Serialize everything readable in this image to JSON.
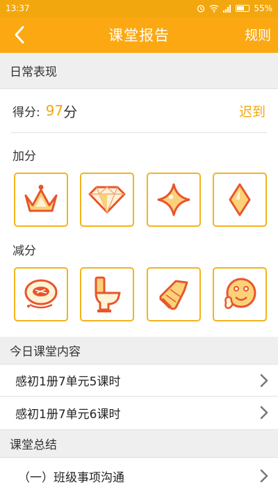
{
  "status": {
    "time": "13:37",
    "battery": "55%"
  },
  "header": {
    "title": "课堂报告",
    "right_action": "规则"
  },
  "daily": {
    "section_title": "日常表现",
    "score_label": "得分:",
    "score_value": "97",
    "score_unit": "分",
    "attendance": "迟到",
    "add_label": "加分",
    "add_icons": [
      "crown-icon",
      "diamond-gem-icon",
      "sparkle-star-icon",
      "rhombus-icon"
    ],
    "deduct_label": "减分",
    "deduct_icons": [
      "food-plate-icon",
      "toilet-icon",
      "shoe-icon",
      "silly-face-icon"
    ]
  },
  "content": {
    "section_title": "今日课堂内容",
    "items": [
      {
        "label": "感初1册7单元5课时"
      },
      {
        "label": "感初1册7单元6课时"
      }
    ]
  },
  "summary": {
    "section_title": "课堂总结",
    "items": [
      {
        "label": "（一）班级事项沟通"
      }
    ]
  },
  "colors": {
    "accent": "#fba812",
    "icon_stroke": "#e8552b",
    "icon_fill": "#fbd27a"
  }
}
